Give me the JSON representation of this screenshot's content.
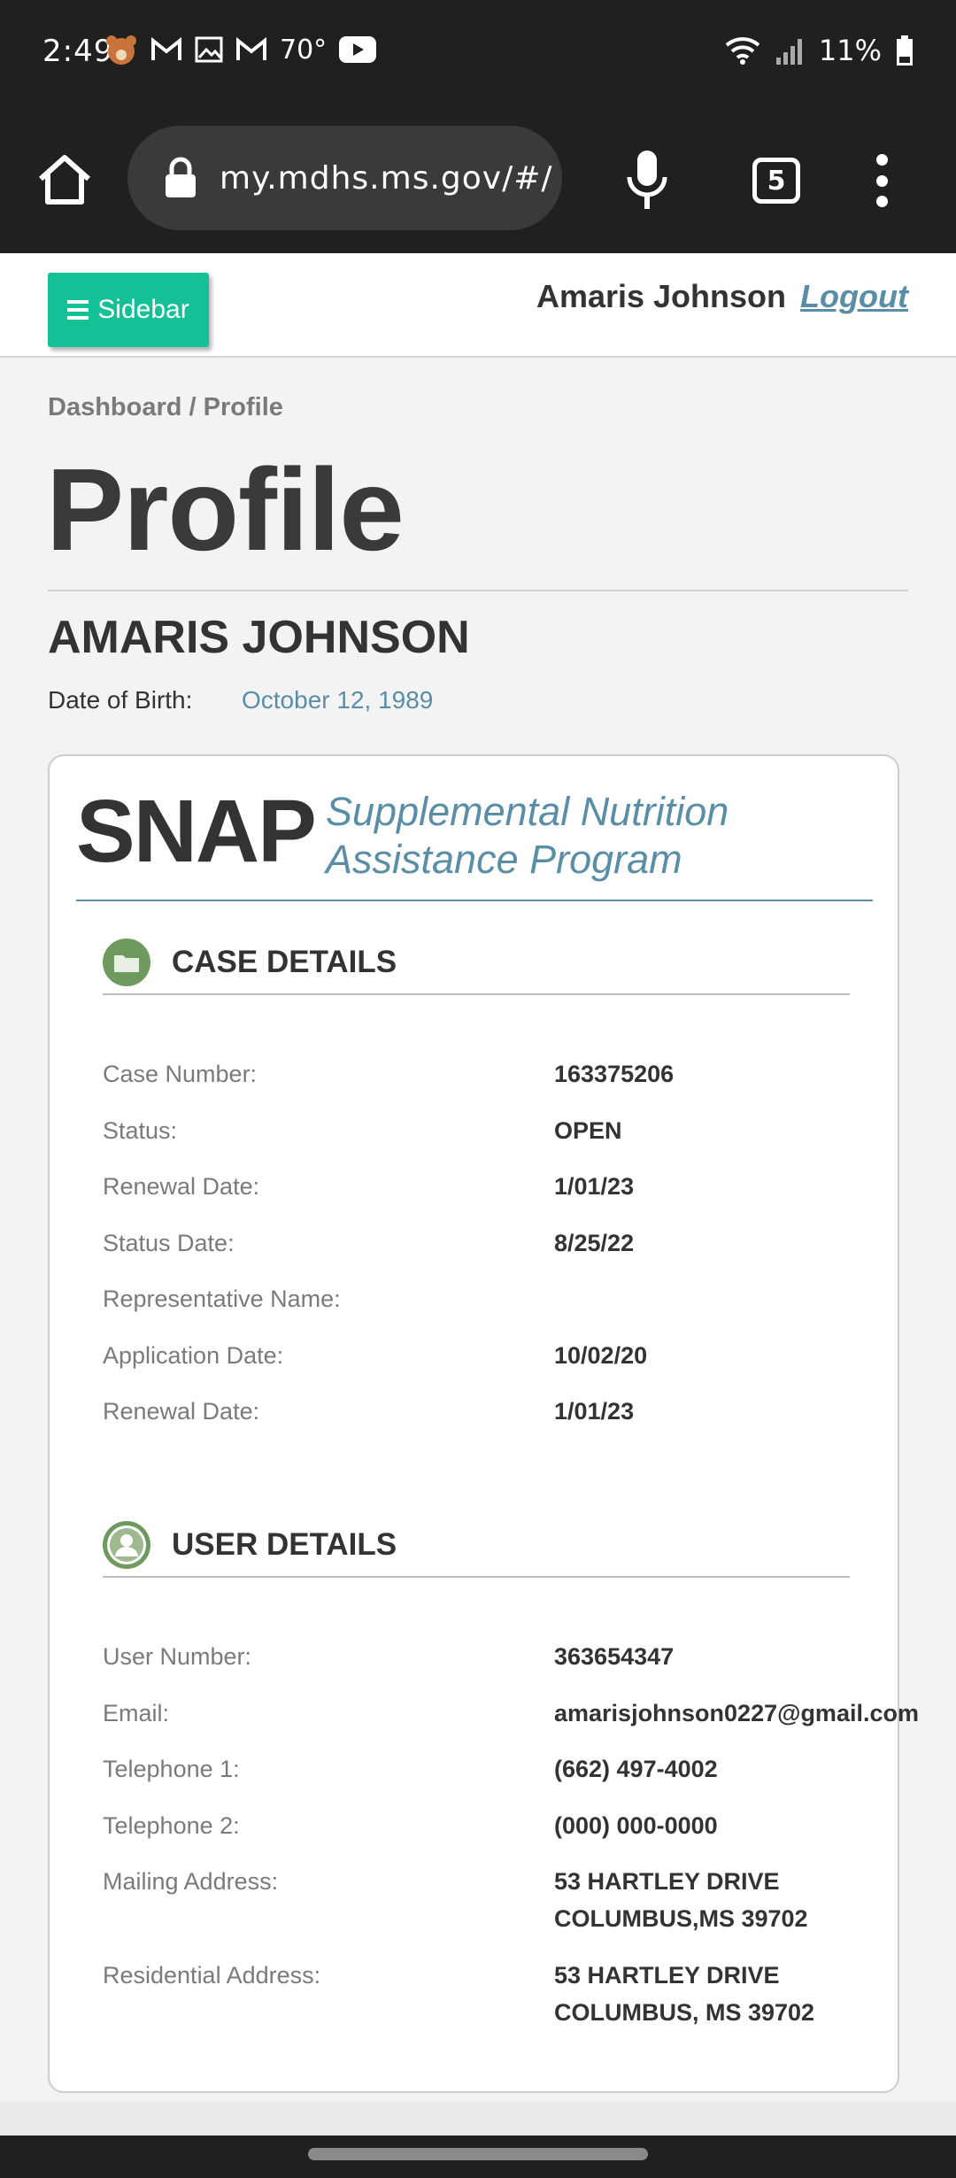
{
  "status_bar": {
    "time": "2:49",
    "temperature": "70°",
    "battery": "11%"
  },
  "browser": {
    "url": "my.mdhs.ms.gov/#/",
    "tab_count": "5"
  },
  "header": {
    "sidebar_label": "Sidebar",
    "user_name": "Amaris Johnson",
    "logout_label": "Logout"
  },
  "breadcrumb": "Dashboard / Profile",
  "page_title": "Profile",
  "person": {
    "name": "AMARIS JOHNSON",
    "dob_label": "Date of Birth:",
    "dob_value": "October 12, 1989"
  },
  "program": {
    "acronym": "SNAP",
    "full_name_line1": "Supplemental Nutrition",
    "full_name_line2": "Assistance Program"
  },
  "case_details": {
    "title": "CASE DETAILS",
    "rows": [
      {
        "label": "Case Number:",
        "value": "163375206"
      },
      {
        "label": "Status:",
        "value": "OPEN"
      },
      {
        "label": "Renewal Date:",
        "value": "1/01/23"
      },
      {
        "label": "Status Date:",
        "value": "8/25/22"
      },
      {
        "label": "Representative Name:",
        "value": ""
      },
      {
        "label": "Application Date:",
        "value": "10/02/20"
      },
      {
        "label": "Renewal Date:",
        "value": "1/01/23"
      }
    ]
  },
  "user_details": {
    "title": "USER DETAILS",
    "rows": [
      {
        "label": "User Number:",
        "value": "363654347"
      },
      {
        "label": "Email:",
        "value": "amarisjohnson0227@gmail.com"
      },
      {
        "label": "Telephone 1:",
        "value": "(662) 497-4002"
      },
      {
        "label": "Telephone 2:",
        "value": "(000) 000-0000"
      },
      {
        "label": "Mailing Address:",
        "value_line1": "53 HARTLEY DRIVE",
        "value_line2": "COLUMBUS,MS 39702"
      },
      {
        "label": "Residential Address:",
        "value_line1": "53 HARTLEY DRIVE",
        "value_line2": "COLUMBUS, MS 39702"
      }
    ]
  },
  "colors": {
    "accent_green": "#14c096",
    "link_blue": "#5a8ea6",
    "icon_green": "#6f9a5e"
  }
}
